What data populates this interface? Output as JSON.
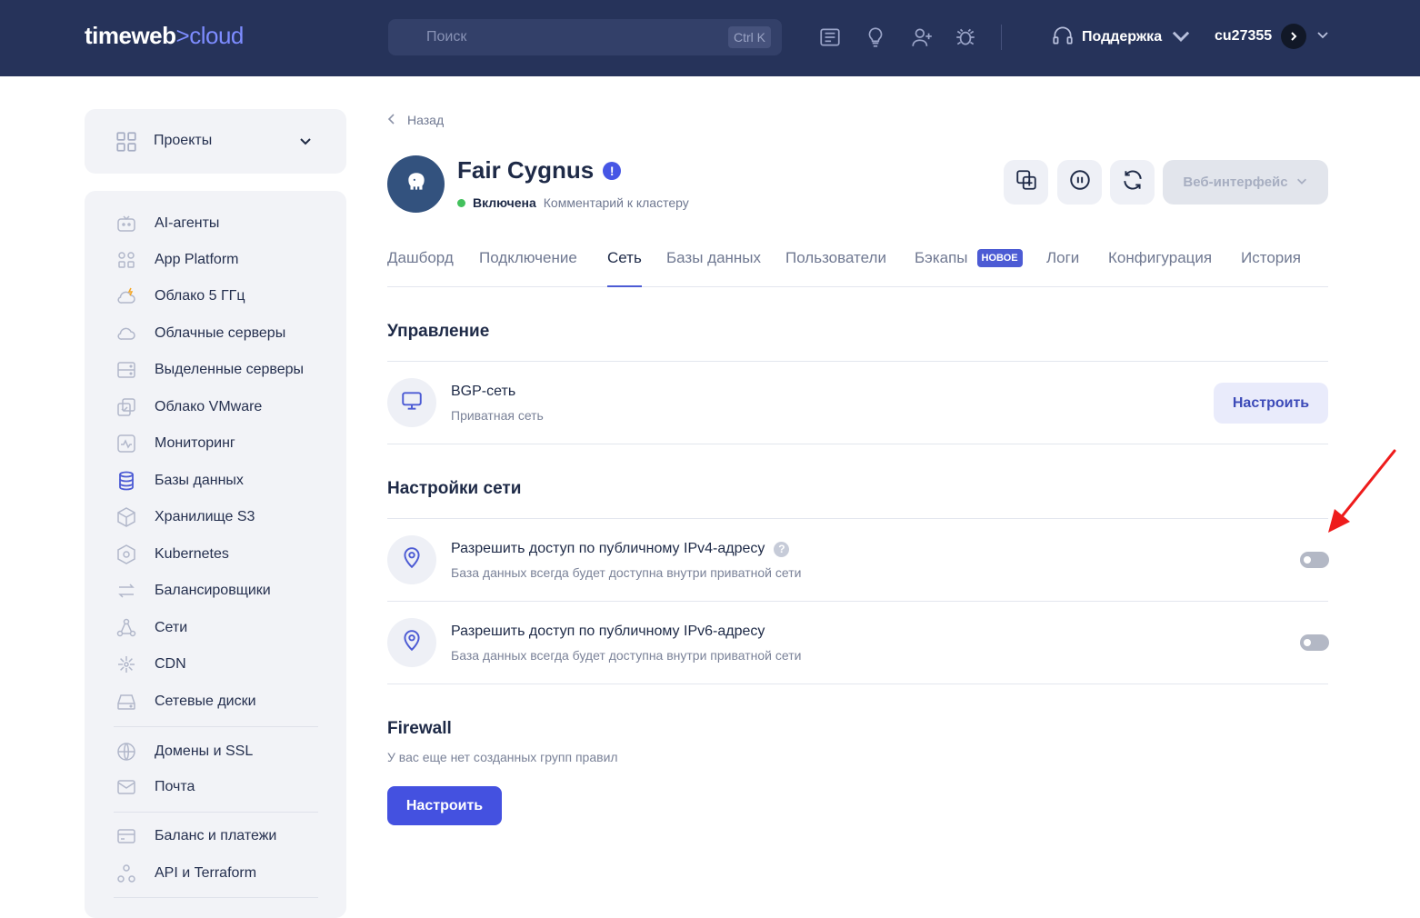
{
  "header": {
    "logo_left": "timeweb",
    "logo_sep": ">",
    "logo_right": "cloud",
    "search_placeholder": "Поиск",
    "search_shortcut": "Ctrl K",
    "icons": [
      "news-icon",
      "lightbulb-icon",
      "add-user-icon",
      "bug-icon"
    ],
    "support_label": "Поддержка",
    "user_id": "cu27355"
  },
  "sidebar": {
    "projects_label": "Проекты",
    "items": [
      {
        "label": "AI-агенты",
        "icon": "robot-icon"
      },
      {
        "label": "App Platform",
        "icon": "apps-icon"
      },
      {
        "label": "Облако 5 ГГц",
        "icon": "cloud-bolt-icon"
      },
      {
        "label": "Облачные серверы",
        "icon": "cloud-icon"
      },
      {
        "label": "Выделенные серверы",
        "icon": "server-icon"
      },
      {
        "label": "Облако VMware",
        "icon": "vmware-icon"
      },
      {
        "label": "Мониторинг",
        "icon": "monitoring-icon"
      },
      {
        "label": "Базы данных",
        "icon": "database-icon",
        "active": true
      },
      {
        "label": "Хранилище S3",
        "icon": "storage-cube-icon"
      },
      {
        "label": "Kubernetes",
        "icon": "kubernetes-icon"
      },
      {
        "label": "Балансировщики",
        "icon": "balancer-arrows-icon"
      },
      {
        "label": "Сети",
        "icon": "network-icon"
      },
      {
        "label": "CDN",
        "icon": "cdn-icon"
      },
      {
        "label": "Сетевые диски",
        "icon": "disk-icon"
      },
      {
        "label": "Домены и SSL",
        "icon": "globe-icon"
      },
      {
        "label": "Почта",
        "icon": "mail-icon"
      },
      {
        "label": "Баланс и платежи",
        "icon": "wallet-icon"
      },
      {
        "label": "API и Terraform",
        "icon": "api-icon"
      }
    ]
  },
  "page": {
    "back_label": "Назад",
    "cluster_name": "Fair Cygnus",
    "status": "Включена",
    "comment": "Комментарий к кластеру",
    "web_interface_label": "Веб-интерфейс",
    "tabs": [
      {
        "label": "Дашборд"
      },
      {
        "label": "Подключение"
      },
      {
        "label": "Сеть",
        "active": true
      },
      {
        "label": "Базы данных"
      },
      {
        "label": "Пользователи"
      },
      {
        "label": "Бэкапы",
        "badge": "НОВОЕ"
      },
      {
        "label": "Логи"
      },
      {
        "label": "Конфигурация"
      },
      {
        "label": "История"
      }
    ]
  },
  "management": {
    "heading": "Управление",
    "bgp_title": "BGP-сеть",
    "bgp_subtitle": "Приватная сеть",
    "configure_label": "Настроить"
  },
  "network_settings": {
    "heading": "Настройки сети",
    "ipv4_title": "Разрешить доступ по публичному IPv4-адресу",
    "ipv4_subtitle": "База данных всегда будет доступна внутри приватной сети",
    "ipv4_enabled": false,
    "ipv6_title": "Разрешить доступ по публичному IPv6-адресу",
    "ipv6_subtitle": "База данных всегда будет доступна внутри приватной сети",
    "ipv6_enabled": false
  },
  "firewall": {
    "heading": "Firewall",
    "empty_text": "У вас еще нет созданных групп правил",
    "configure_label": "Настроить"
  },
  "colors": {
    "header_bg": "#26335a",
    "accent": "#4c5bd4",
    "primary_button": "#4451e0",
    "status_on": "#43c15d",
    "annotation_arrow": "#ee1c1c"
  }
}
